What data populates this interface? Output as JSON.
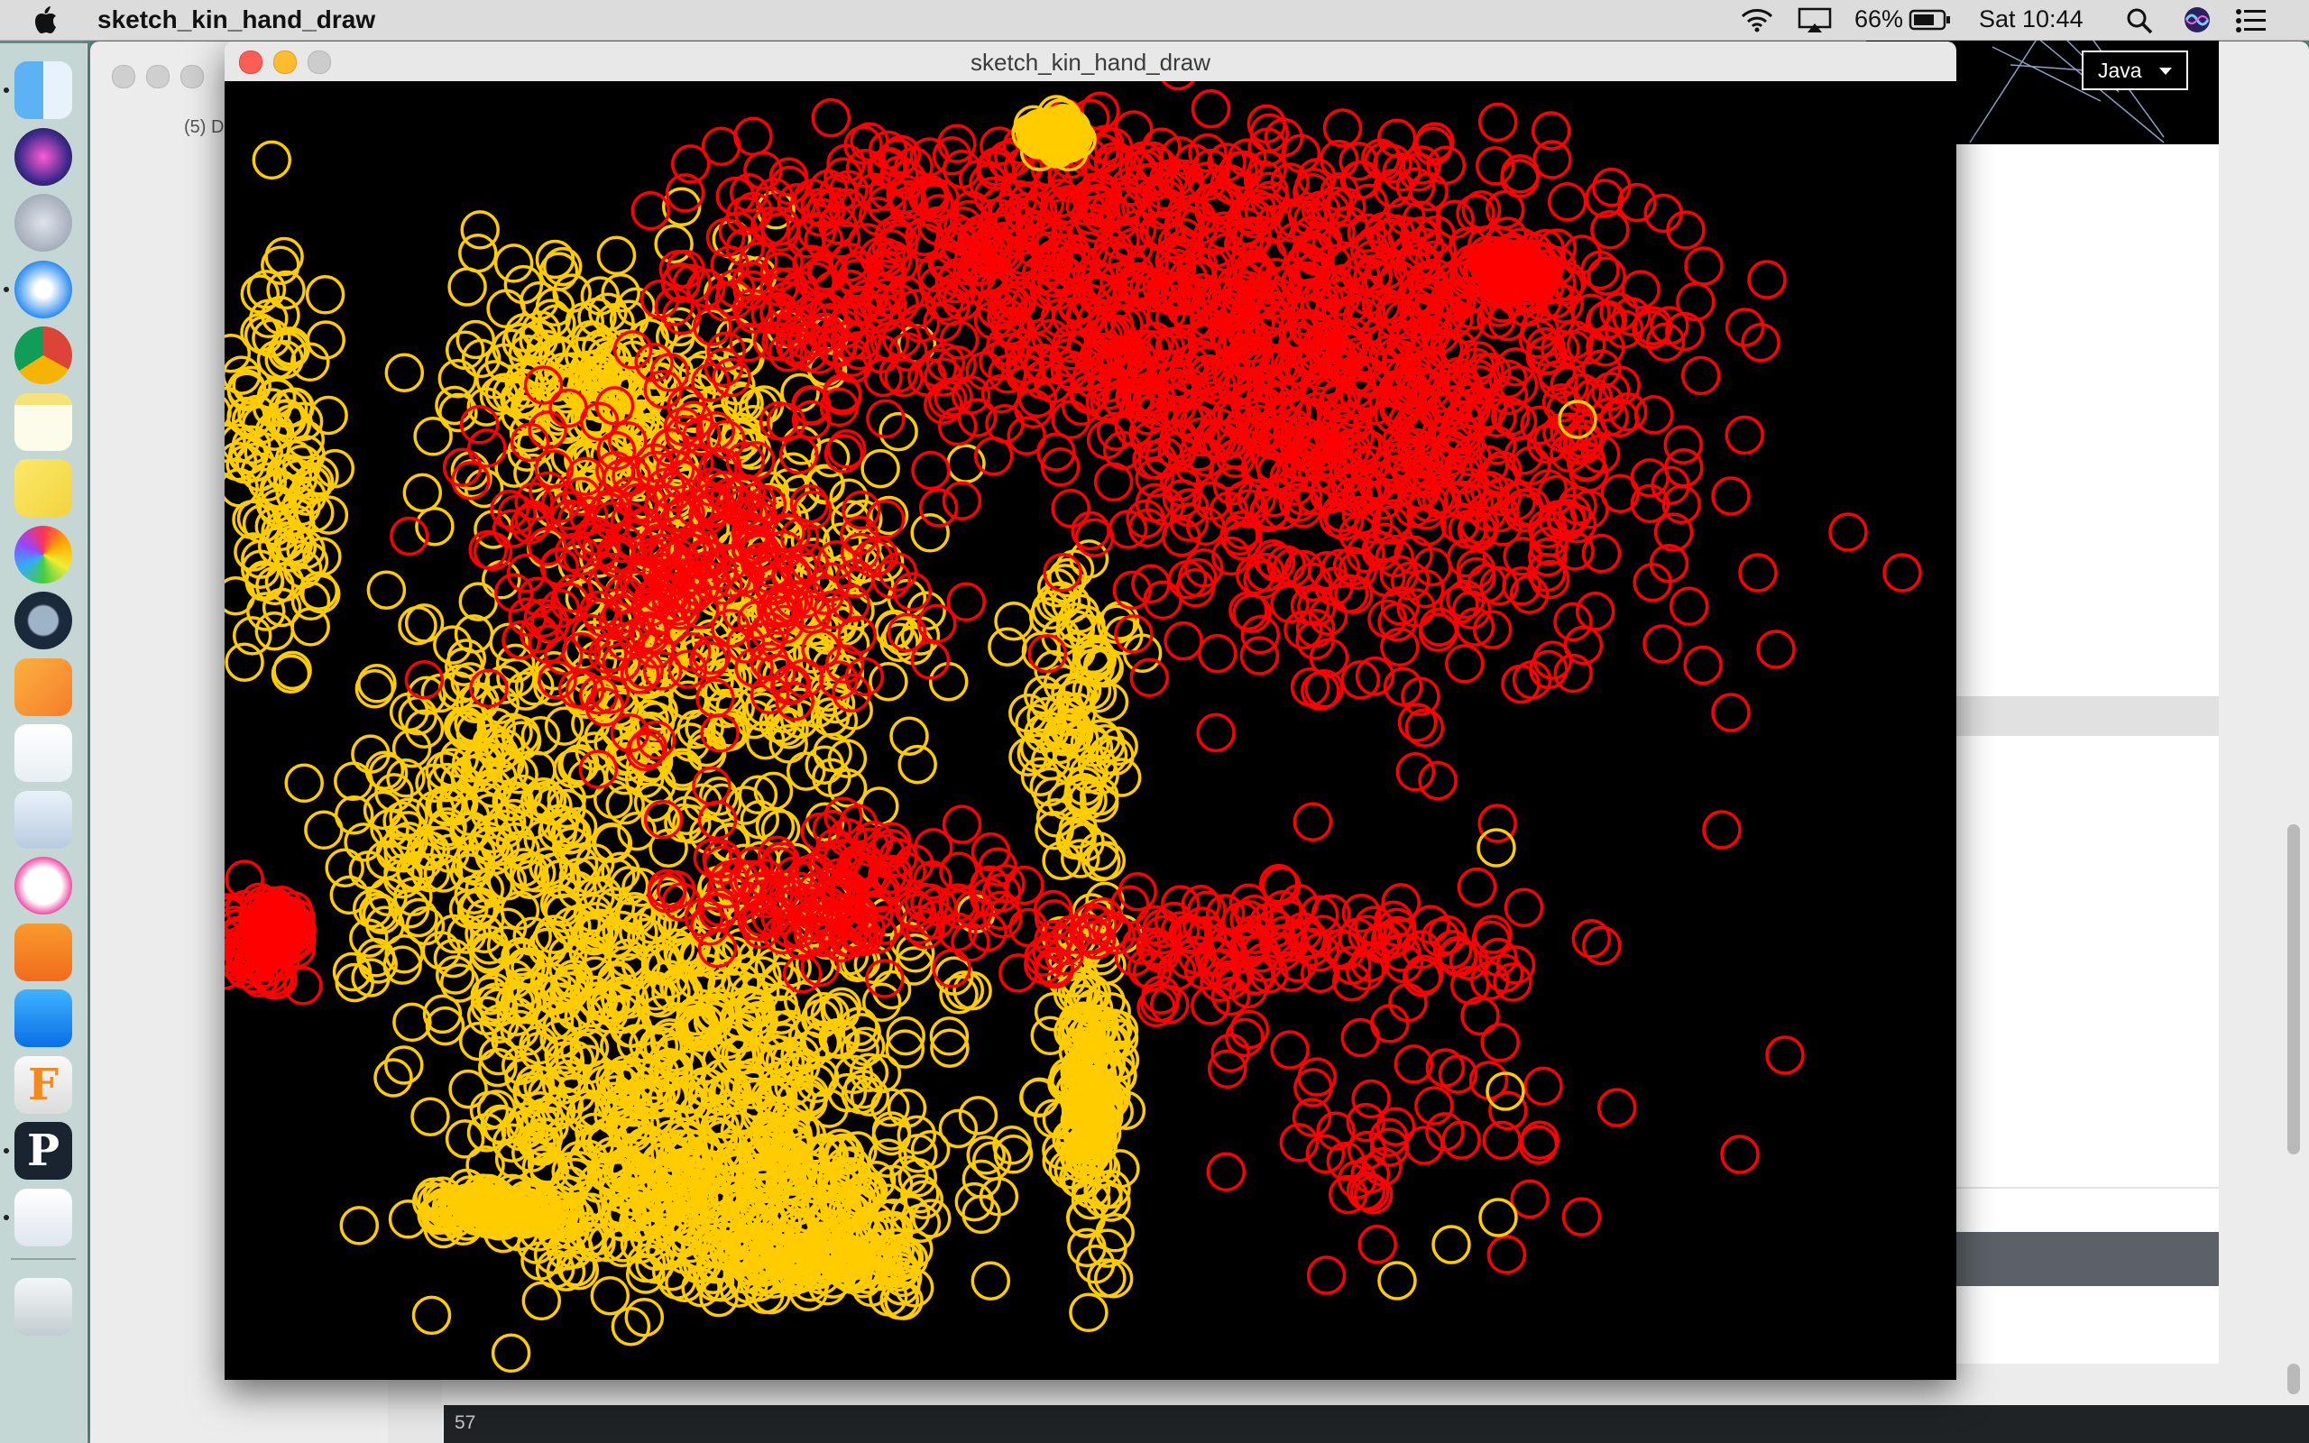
{
  "menubar": {
    "app_name": "sketch_kin_hand_draw",
    "battery_percent": "66%",
    "clock": "Sat 10:44",
    "icons": [
      "apple-icon",
      "wifi-icon",
      "airplay-icon",
      "battery-icon",
      "search-icon",
      "siri-icon",
      "notification-center-icon"
    ]
  },
  "dock": {
    "items": [
      {
        "name": "finder",
        "running": true
      },
      {
        "name": "siri",
        "running": false
      },
      {
        "name": "launchpad",
        "running": false
      },
      {
        "name": "safari",
        "running": true
      },
      {
        "name": "chrome",
        "running": false
      },
      {
        "name": "notes",
        "running": false
      },
      {
        "name": "stickies",
        "running": false
      },
      {
        "name": "photos",
        "running": false
      },
      {
        "name": "quicktime",
        "running": false
      },
      {
        "name": "pages",
        "running": false
      },
      {
        "name": "numbers",
        "running": false
      },
      {
        "name": "keynote",
        "running": false
      },
      {
        "name": "itunes",
        "running": false
      },
      {
        "name": "ibooks",
        "running": false
      },
      {
        "name": "app-store",
        "running": false
      },
      {
        "name": "fusion-360",
        "running": false
      },
      {
        "name": "processing",
        "running": true
      },
      {
        "name": "java",
        "running": true
      },
      {
        "name": "trash",
        "running": false
      }
    ]
  },
  "pde": {
    "tab_label": "(5) D",
    "mode_label": "Java",
    "console_line": "57"
  },
  "sketch": {
    "title": "sketch_kin_hand_draw",
    "colors": {
      "yellow": "#ffcc00",
      "red": "#ff0000",
      "background": "#000000"
    }
  }
}
